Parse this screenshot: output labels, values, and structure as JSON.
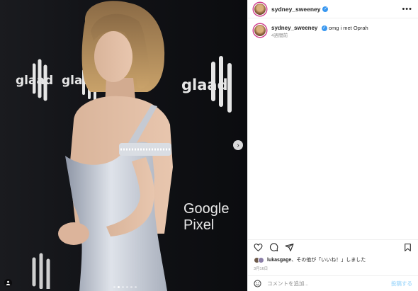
{
  "post": {
    "username": "sydney_sweeney",
    "caption_user": "sydney_sweeney",
    "caption_text": "omg i met Oprah",
    "caption_time": "4週間前",
    "likes_user": "lukasgage",
    "likes_suffix": "、その他が「いいね！」しました",
    "date": "3月16日"
  },
  "photo": {
    "logos": [
      "glaad",
      "glaad",
      "glaad",
      "Google Pixel"
    ],
    "dots_count": 6,
    "active_dot": 1
  },
  "comment": {
    "placeholder": "コメントを追加...",
    "post_label": "投稿する"
  },
  "icons": {
    "more": "more-icon",
    "heart": "heart-icon",
    "comment": "comment-icon",
    "share": "share-icon",
    "save": "bookmark-icon",
    "emoji": "emoji-icon",
    "next": "chevron-right-icon",
    "tag": "user-tag-icon"
  },
  "colors": {
    "accent": "#3897f0",
    "ring": "#d03b8d",
    "post_disabled": "#b2dffc"
  }
}
